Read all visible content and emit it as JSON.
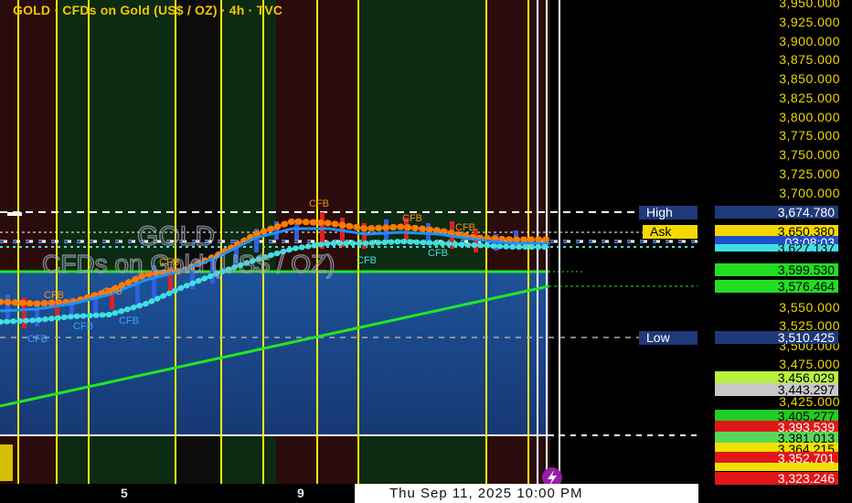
{
  "title": "GOLD · CFDs on Gold (US$ / OZ) · 4h · TVC",
  "watermark": {
    "symbol": "GOLD",
    "description": "CFDs on Gold (US$ / OZ)"
  },
  "price_axis": {
    "ticks": [
      "3,950.000",
      "3,925.000",
      "3,900.000",
      "3,875.000",
      "3,850.000",
      "3,825.000",
      "3,800.000",
      "3,775.000",
      "3,750.000",
      "3,725.000",
      "3,700.000",
      "3,550.000",
      "3,525.000",
      "3,500.000",
      "3,475.000",
      "3,425.000"
    ]
  },
  "price_badges": [
    {
      "label": "High",
      "value": "3,674.780",
      "bg": "#1f3a78",
      "fg": "#ffffff"
    },
    {
      "label": "Ask",
      "value": "3,650.380",
      "bg": "#f5d800",
      "fg": "#000000"
    },
    {
      "value": "03:08:03",
      "bg": "#1e50c8",
      "fg": "#ffffff"
    },
    {
      "value": "3,627.137",
      "bg": "#40e0e0",
      "fg": "#000000"
    },
    {
      "value": "3,599.530",
      "bg": "#22dd22",
      "fg": "#000000"
    },
    {
      "value": "3,576.464",
      "bg": "#22dd22",
      "fg": "#000000"
    },
    {
      "label": "Low",
      "value": "3,510.425",
      "bg": "#1f3a78",
      "fg": "#ffffff"
    },
    {
      "value": "3,456.029",
      "bg": "#b8f040",
      "fg": "#000000"
    },
    {
      "value": "3,443.297",
      "bg": "#c8c8c8",
      "fg": "#000000"
    },
    {
      "value": "3,405.277",
      "bg": "#22cc22",
      "fg": "#000000"
    },
    {
      "value": "3,393.539",
      "bg": "#e01818",
      "fg": "#ffffff"
    },
    {
      "value": "3,381.013",
      "bg": "#58d858",
      "fg": "#000000"
    },
    {
      "value": "3,364.215",
      "bg": "#f0e000",
      "fg": "#000000"
    },
    {
      "value": "3,352.701",
      "bg": "#e01818",
      "fg": "#ffffff"
    },
    {
      "value": "3,323.246",
      "bg": "#e01818",
      "fg": "#ffffff"
    }
  ],
  "time_axis": {
    "labels": [
      "5",
      "9"
    ],
    "crosshair": "Thu Sep 11, 2025   10:00 PM"
  },
  "markers": [
    "CFB",
    "CFB",
    "CFB",
    "CFB",
    "CFB",
    "CFB",
    "CFB",
    "CFB",
    "CFB",
    "CFB",
    "CFB"
  ],
  "colors": {
    "accent": "#f0c800",
    "band_fill": "#1d4a8e",
    "ema": "#22e622",
    "background": "#000000"
  }
}
